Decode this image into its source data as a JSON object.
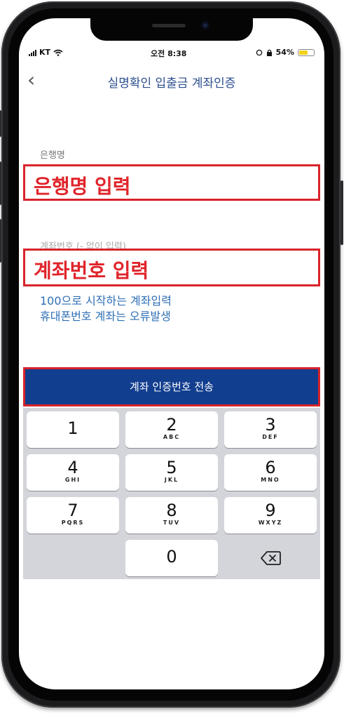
{
  "status_bar": {
    "carrier": "KT",
    "time": "오전 8:38",
    "battery": "54%",
    "battery_level": 0.54
  },
  "header": {
    "back_icon": "chevron-left-icon",
    "title": "실명확인 입출금 계좌인증"
  },
  "bank_field": {
    "label": "은행명",
    "overlay_text": "은행명 입력"
  },
  "account_field": {
    "label": "계좌번호 (- 없이 입력)",
    "overlay_text": "계좌번호 입력"
  },
  "notes": {
    "line1": "100으로 시작하는 계좌입력",
    "line2": "휴대폰번호 계좌는 오류발생"
  },
  "send_button": {
    "label": "계좌 인증번호 전송"
  },
  "keypad": {
    "keys": [
      {
        "num": "1",
        "letters": ""
      },
      {
        "num": "2",
        "letters": "ABC"
      },
      {
        "num": "3",
        "letters": "DEF"
      },
      {
        "num": "4",
        "letters": "GHI"
      },
      {
        "num": "5",
        "letters": "JKL"
      },
      {
        "num": "6",
        "letters": "MNO"
      },
      {
        "num": "7",
        "letters": "PQRS"
      },
      {
        "num": "8",
        "letters": "TUV"
      },
      {
        "num": "9",
        "letters": "WXYZ"
      },
      {
        "num": "0",
        "letters": ""
      }
    ],
    "delete_icon": "backspace-icon"
  },
  "colors": {
    "title": "#2d4f8f",
    "highlight_border": "#d8232a",
    "button_bg": "#123e8f",
    "note_text": "#2e6fb6"
  }
}
